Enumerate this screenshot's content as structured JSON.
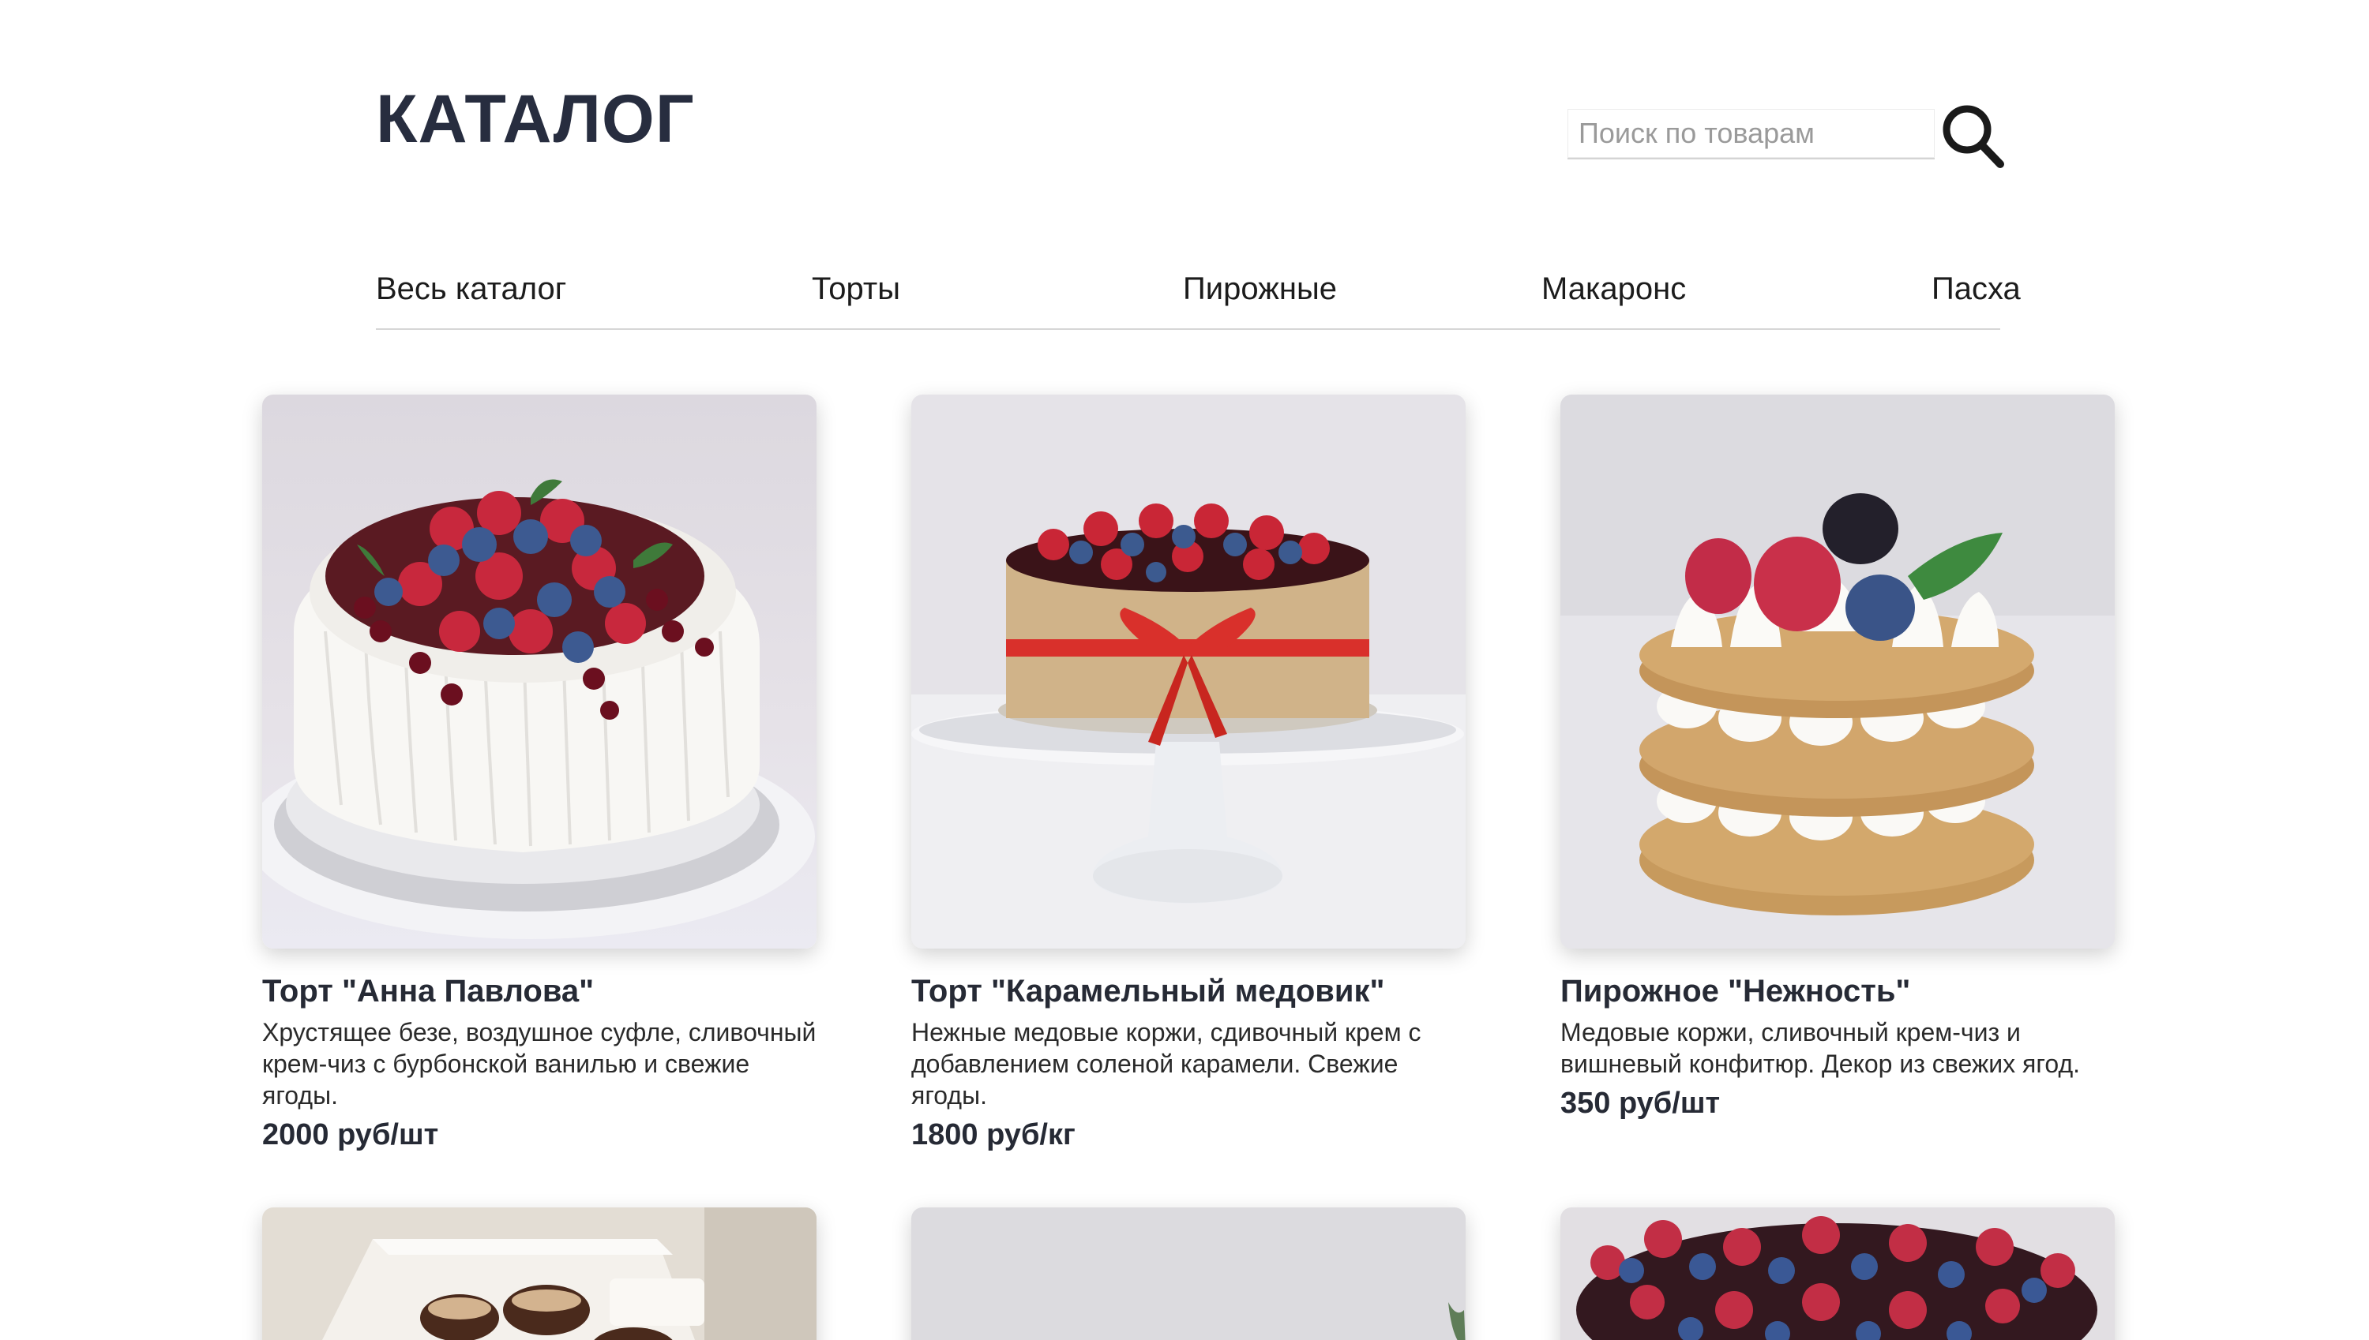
{
  "header": {
    "title": "КАТАЛОГ"
  },
  "search": {
    "placeholder": "Поиск по товарам",
    "icon": "search-icon"
  },
  "nav": {
    "items": [
      {
        "label": "Весь каталог"
      },
      {
        "label": "Торты"
      },
      {
        "label": "Пирожные"
      },
      {
        "label": "Макаронс"
      },
      {
        "label": "Пасха"
      }
    ]
  },
  "products": [
    {
      "title": "Торт \"Анна Павлова\"",
      "description": "Хрустящее безе, воздушное суфле, сливочный крем-чиз с бурбонской ванилью и свежие ягоды.",
      "price": "2000 руб/шт",
      "image": "pavlova-cake"
    },
    {
      "title": "Торт \"Карамельный медовик\"",
      "description": "Нежные медовые коржи, сдивочный крем с добавлением соленой карамели. Свежие ягоды.",
      "price": "1800 руб/кг",
      "image": "caramel-honey-cake"
    },
    {
      "title": "Пирожное \"Нежность\"",
      "description": "Медовые коржи, сливочный крем-чиз и вишневый конфитюр. Декор из свежих ягод.",
      "price": "350 руб/шт",
      "image": "nezhnost-pastry"
    },
    {
      "image": "pastry-box"
    },
    {
      "image": "plain-backdrop"
    },
    {
      "image": "berry-cake"
    }
  ]
}
